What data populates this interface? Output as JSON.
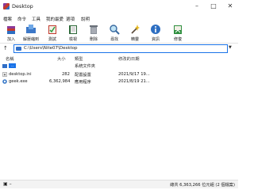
{
  "window": {
    "title": "Desktop"
  },
  "menu": {
    "items": [
      "檔案",
      "命令",
      "工具",
      "我的最愛",
      "選項",
      "說明"
    ]
  },
  "toolbar": {
    "buttons": [
      {
        "label": "加入",
        "icon": "add-archive-icon"
      },
      {
        "label": "解壓縮到",
        "icon": "extract-to-icon"
      },
      {
        "label": "測試",
        "icon": "test-icon"
      },
      {
        "label": "檢視",
        "icon": "view-icon"
      },
      {
        "label": "刪除",
        "icon": "delete-icon"
      },
      {
        "label": "尋找",
        "icon": "find-icon"
      },
      {
        "label": "精靈",
        "icon": "wizard-icon"
      },
      {
        "label": "資訊",
        "icon": "info-icon"
      },
      {
        "label": "修復",
        "icon": "repair-icon"
      }
    ]
  },
  "address": {
    "path": "C:\\Users\\Nite07\\Desktop"
  },
  "columns": {
    "name": "名稱",
    "size": "大小",
    "type": "類型",
    "modified": "修改的日期"
  },
  "files": [
    {
      "name": "..",
      "size": "",
      "type": "系統文件夾",
      "modified": ""
    },
    {
      "name": "desktop.ini",
      "size": "282",
      "type": "配置設置",
      "modified": "2021/9/17 19..."
    },
    {
      "name": "geek.exe",
      "size": "6,362,984",
      "type": "應用程序",
      "modified": "2021/8/19 21..."
    }
  ],
  "status": {
    "total": "總共 6,363,266 位元組 (2 個檔案)"
  }
}
